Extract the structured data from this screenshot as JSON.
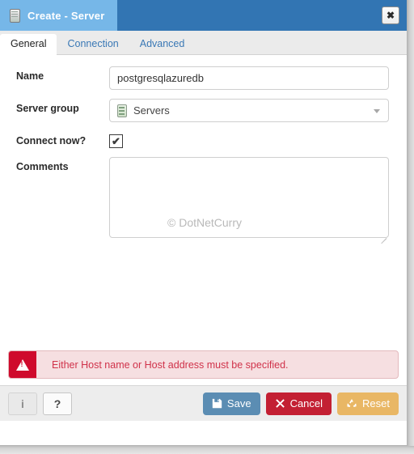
{
  "window": {
    "title": "Create - Server",
    "title_icon": "server-icon",
    "close_label": "✖"
  },
  "tabs": [
    {
      "label": "General",
      "active": true
    },
    {
      "label": "Connection",
      "active": false
    },
    {
      "label": "Advanced",
      "active": false
    }
  ],
  "form": {
    "name": {
      "label": "Name",
      "value": "postgresqlazuredb",
      "placeholder": ""
    },
    "server_group": {
      "label": "Server group",
      "value": "Servers",
      "icon": "server-group-icon",
      "caret": "chevron-down-icon"
    },
    "connect_now": {
      "label": "Connect now?",
      "checked": true,
      "check_glyph": "✔"
    },
    "comments": {
      "label": "Comments",
      "value": "",
      "placeholder": ""
    }
  },
  "watermark": "© DotNetCurry",
  "error": {
    "icon": "warning-triangle-icon",
    "message": "Either Host name or Host address must be specified."
  },
  "footer": {
    "info_label": "i",
    "help_label": "?",
    "save_label": "Save",
    "cancel_label": "Cancel",
    "reset_label": "Reset"
  },
  "colors": {
    "titlebar": "#3275b3",
    "titlebar_tab": "#76b7e8",
    "tab_link": "#3a78b5",
    "error_accent": "#cf0a2c",
    "error_bg": "#f6dfe1",
    "error_text": "#d0324a",
    "save": "#5b8db3",
    "cancel": "#c32033",
    "reset": "#e9b765"
  }
}
